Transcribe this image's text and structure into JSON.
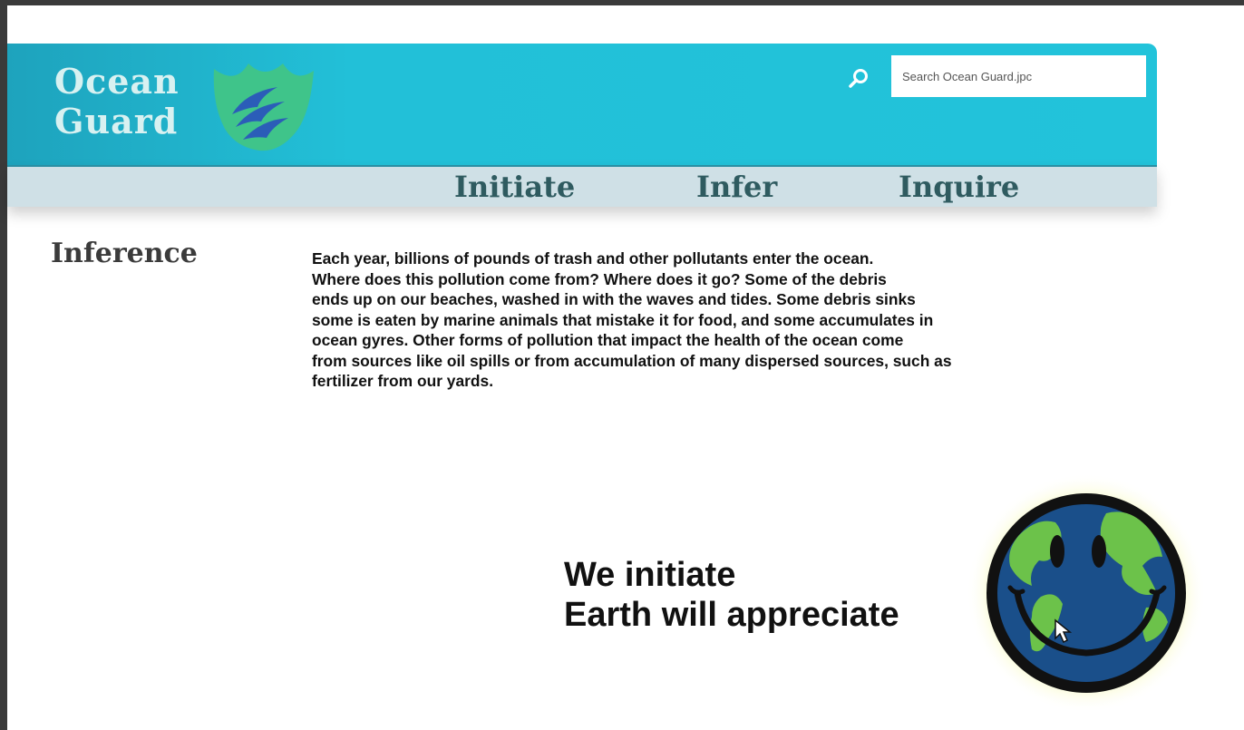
{
  "brand": {
    "line1": "Ocean",
    "line2": "Guard",
    "logo_icon": "wave-shield-icon"
  },
  "search": {
    "icon": "search-icon",
    "placeholder": "Search Ocean Guard.jpc"
  },
  "nav": {
    "items": [
      {
        "label": "Initiate"
      },
      {
        "label": "Infer"
      },
      {
        "label": "Inquire"
      }
    ]
  },
  "content": {
    "title": "Inference",
    "paragraph_lines": [
      "Each year, billions of pounds of trash and other pollutants enter the ocean.",
      "Where does this pollution come from? Where does it go? Some of the debris",
      "ends up on our beaches, washed in with the waves and tides. Some debris sinks",
      "some is eaten by marine animals that mistake it for food, and some accumulates in",
      "ocean gyres. Other forms of pollution that impact the health of the ocean come",
      "from sources like oil spills or from accumulation of many dispersed sources, such as",
      "fertilizer from our yards."
    ]
  },
  "slogan": {
    "line1": "We initiate",
    "line2": "Earth will appreciate"
  },
  "illustration": {
    "icon": "smiling-earth-icon"
  },
  "colors": {
    "header": "#22c0d8",
    "navbar": "#cfe0e6",
    "nav_text": "#2f5b60",
    "logo_text": "#d8f1f1",
    "shield": "#3fc48a",
    "ocean": "#1a4f8a",
    "land": "#6cc24a"
  }
}
